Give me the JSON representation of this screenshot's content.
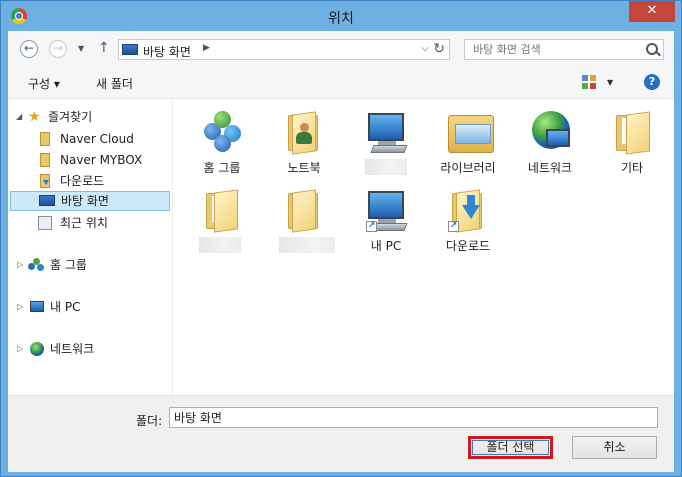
{
  "window": {
    "title": "위치",
    "close_glyph": "✕"
  },
  "navigation": {
    "back_glyph": "←",
    "forward_glyph": "→",
    "recent_glyph": "▼",
    "up_glyph": "↑",
    "address": {
      "path": "바탕 화면",
      "crumb_arrow": "▶",
      "dropdown_glyph": "⌵",
      "refresh_glyph": "↻"
    },
    "search": {
      "placeholder": "바탕 화면 검색"
    }
  },
  "toolbar": {
    "organize_label": "구성 ▾",
    "new_folder_label": "새 폴더",
    "view_drop": "▼",
    "help_glyph": "?"
  },
  "nav_pane": {
    "favorites": {
      "expander": "◢",
      "label": "즐겨찾기"
    },
    "items": [
      {
        "label": "Naver Cloud"
      },
      {
        "label": "Naver MYBOX"
      },
      {
        "label": "다운로드"
      },
      {
        "label": "바탕 화면"
      },
      {
        "label": "최근 위치"
      }
    ],
    "homegroup": {
      "expander": "▷",
      "label": "홈 그룹"
    },
    "pc": {
      "expander": "▷",
      "label": "내 PC"
    },
    "network": {
      "expander": "▷",
      "label": "네트워크"
    }
  },
  "content": {
    "tiles": [
      {
        "label": "홈 그룹",
        "icon": "homegroup-icon"
      },
      {
        "label": "노트북",
        "icon": "user-folder-icon"
      },
      {
        "label": "",
        "icon": "computer-icon"
      },
      {
        "label": "라이브러리",
        "icon": "library-icon"
      },
      {
        "label": "네트워크",
        "icon": "network-icon"
      },
      {
        "label": "기타",
        "icon": "folder-icon"
      },
      {
        "label": "",
        "icon": "folder-icon"
      },
      {
        "label": "",
        "icon": "folder-icon"
      },
      {
        "label": "내 PC",
        "icon": "computer-shortcut-icon"
      },
      {
        "label": "다운로드",
        "icon": "downloads-shortcut-icon"
      }
    ]
  },
  "bottom": {
    "folder_label": "폴더:",
    "folder_value": "바탕 화면",
    "select_button": "폴더 선택",
    "cancel_button": "취소"
  },
  "colors": {
    "highlight_border": "#d9141b",
    "selection_bg": "#cde8fa",
    "titlebar": "#6fb0e3",
    "close": "#c7463a"
  }
}
